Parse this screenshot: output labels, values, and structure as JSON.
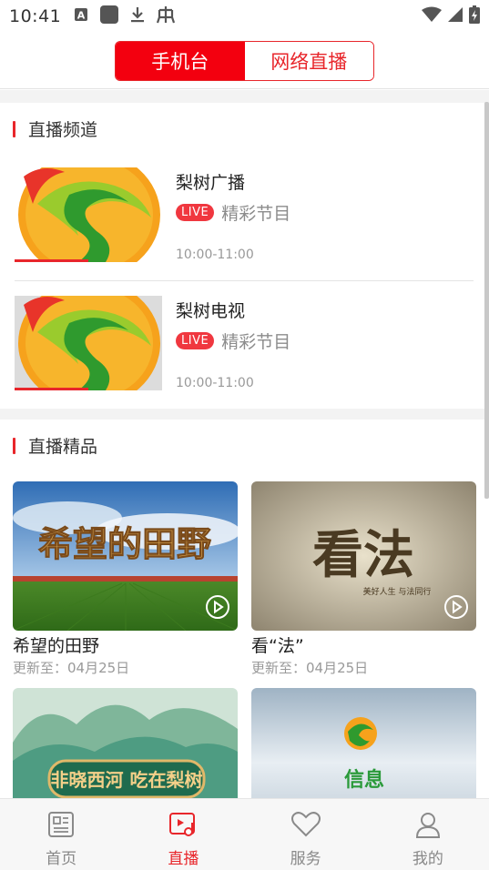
{
  "status_bar": {
    "time": "10:41",
    "icons": [
      "font-a-icon",
      "app-square-icon",
      "download-icon",
      "bug-icon"
    ],
    "right_icons": [
      "wifi-icon",
      "signal-icon",
      "battery-charging-icon"
    ]
  },
  "header": {
    "tabs": [
      {
        "label": "手机台",
        "active": true
      },
      {
        "label": "网络直播",
        "active": false
      }
    ],
    "accent": "#f3000f"
  },
  "live_channels": {
    "section_title": "直播频道",
    "items": [
      {
        "name": "梨树广播",
        "badge": "LIVE",
        "program": "精彩节目",
        "time": "10:00-11:00",
        "progress": 0.5
      },
      {
        "name": "梨树电视",
        "badge": "LIVE",
        "program": "精彩节目",
        "time": "10:00-11:00",
        "progress": 0.5
      }
    ]
  },
  "featured": {
    "section_title": "直播精品",
    "items": [
      {
        "title": "希望的田野",
        "updated": "更新至：04月25日",
        "art_text": "希望的田野"
      },
      {
        "title": "看“法”",
        "updated": "更新至：04月25日",
        "art_text": "看法",
        "art_sub": "美好人生 与法同行"
      },
      {
        "title": "",
        "updated": "",
        "art_text": "非晓西河 吃在梨树"
      },
      {
        "title": "",
        "updated": "",
        "art_text": "信息"
      }
    ]
  },
  "bottom_nav": {
    "items": [
      {
        "label": "首页",
        "icon": "news-icon",
        "active": false
      },
      {
        "label": "直播",
        "icon": "live-music-icon",
        "active": true
      },
      {
        "label": "服务",
        "icon": "heart-icon",
        "active": false
      },
      {
        "label": "我的",
        "icon": "user-icon",
        "active": false
      }
    ]
  },
  "colors": {
    "accent": "#e8262b",
    "live_badge": "#f0373f",
    "muted": "#999999"
  }
}
